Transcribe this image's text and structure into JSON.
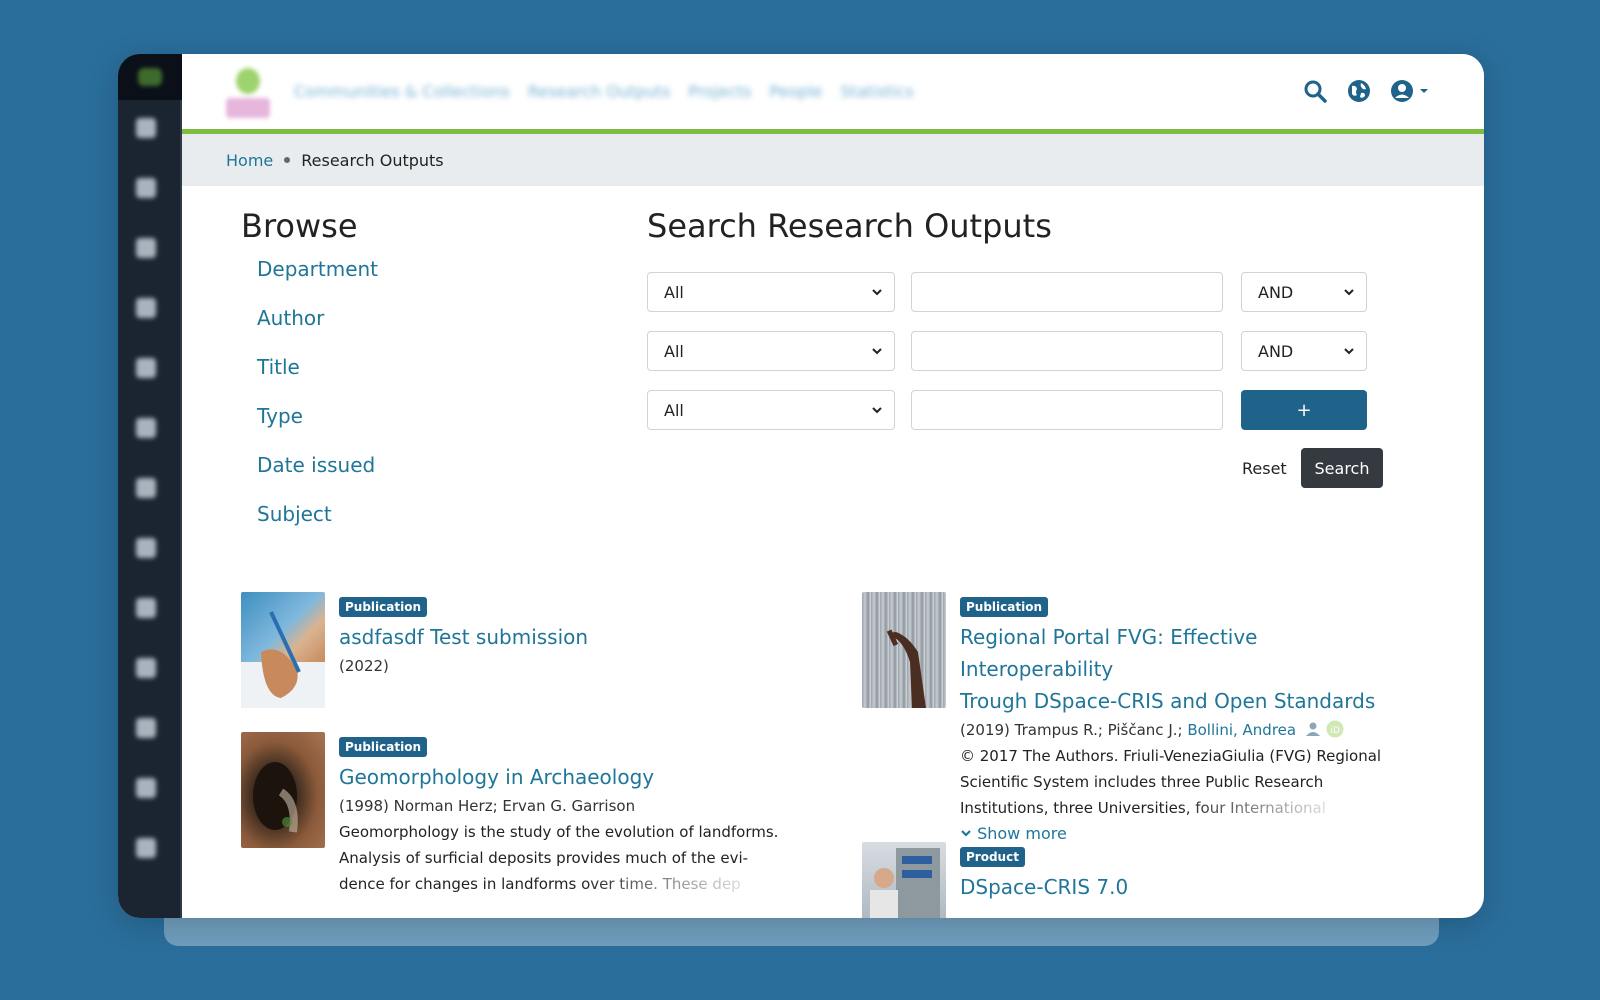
{
  "navbar": {
    "links": [
      "Communities & Collections",
      "Research Outputs",
      "Projects",
      "People",
      "Statistics"
    ]
  },
  "breadcrumb": {
    "home": "Home",
    "current": "Research Outputs"
  },
  "browse": {
    "title": "Browse",
    "items": [
      "Department",
      "Author",
      "Title",
      "Type",
      "Date issued",
      "Subject"
    ]
  },
  "search": {
    "title": "Search Research Outputs",
    "rows": [
      {
        "field": "All",
        "operator": "AND"
      },
      {
        "field": "All",
        "operator": "AND"
      },
      {
        "field": "All"
      }
    ],
    "add_label": "+",
    "reset_label": "Reset",
    "search_label": "Search"
  },
  "results": [
    {
      "badge": "Publication",
      "title": "asdfasdf Test submission",
      "meta": "(2022)"
    },
    {
      "badge": "Publication",
      "title": "Geomorphology in Archaeology",
      "meta": "(1998) Norman Herz; Ervan G. Garrison",
      "abstract_lines": [
        "Geomorphology is the study of the evolution of landforms.",
        "Analysis of surficial deposits provides much of the evi-",
        "dence for changes in landforms over time. These dep"
      ]
    },
    {
      "badge": "Publication",
      "title_lines": [
        "Regional Portal FVG: Effective Interoperability",
        "Trough DSpace-CRIS and Open Standards"
      ],
      "meta_prefix": "(2019) Trampus R.; Piščanc J.; ",
      "meta_link": "Bollini, Andrea",
      "abstract_lines": [
        "© 2017 The Authors. Friuli-VeneziaGiulia (FVG) Regional",
        "Scientific System includes three Public Research",
        "Institutions, three Universities, four International"
      ],
      "show_more": "Show more"
    },
    {
      "badge": "Product",
      "title": "DSpace-CRIS 7.0"
    }
  ],
  "colors": {
    "background": "#2a6e9b",
    "accent_green": "#7fbd41",
    "link_blue": "#207698",
    "badge_blue": "#1f628a",
    "sidebar_dark": "#1b2532"
  }
}
